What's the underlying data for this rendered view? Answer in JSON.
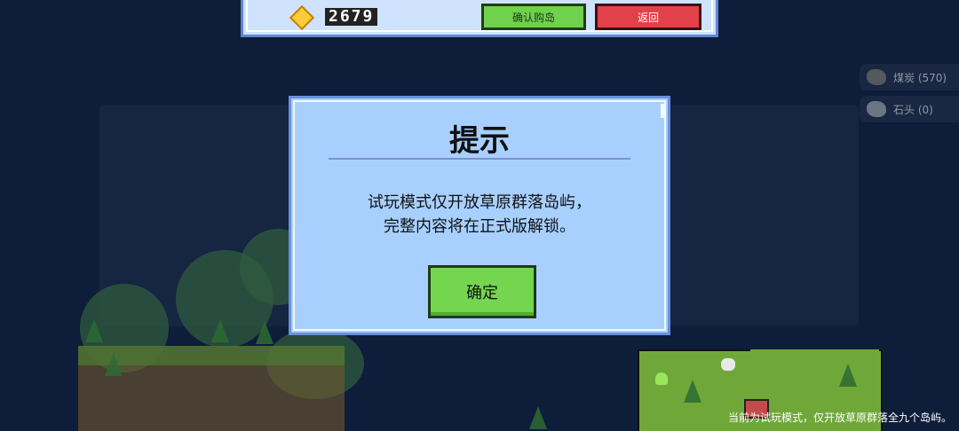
{
  "topbar": {
    "gem_icon": "diamond-gem-icon",
    "gem_count": "2679",
    "confirm_buy_label": "确认购岛",
    "back_label": "返回"
  },
  "side_resources": [
    {
      "icon": "coal-ore-icon",
      "label": "煤炭 (570)"
    },
    {
      "icon": "stone-ore-icon",
      "label": "石头 (0)"
    }
  ],
  "dialog": {
    "title": "提示",
    "message_lines": [
      "试玩模式仅开放草原群落岛屿，",
      "完整内容将在正式版解锁。"
    ],
    "ok_label": "确定"
  },
  "footer": {
    "hint": "当前为试玩模式，仅开放草原群落全九个岛屿。"
  },
  "colors": {
    "background": "#0e1d3a",
    "dialog_fill": "#a8d0ff",
    "dialog_border": "#6b8fdc",
    "confirm_green": "#70d24c",
    "back_red": "#e2414a",
    "gem_gold": "#ffcb3a"
  }
}
